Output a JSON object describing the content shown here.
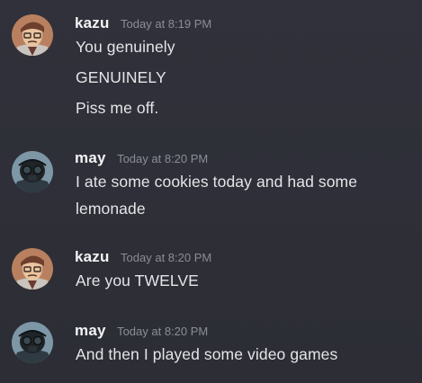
{
  "messages": [
    {
      "author": "kazu",
      "timestamp": "Today at 8:19 PM",
      "avatar": "kazu-avatar",
      "lines": [
        "You genuinely",
        "GENUINELY",
        "Piss me off."
      ]
    },
    {
      "author": "may",
      "timestamp": "Today at 8:20 PM",
      "avatar": "may-avatar",
      "lines": [
        "I ate some cookies today and had some",
        "lemonade"
      ]
    },
    {
      "author": "kazu",
      "timestamp": "Today at 8:20 PM",
      "avatar": "kazu-avatar",
      "lines": [
        "Are you TWELVE"
      ]
    },
    {
      "author": "may",
      "timestamp": "Today at 8:20 PM",
      "avatar": "may-avatar",
      "lines": [
        "And then I played some video games"
      ]
    }
  ],
  "colors": {
    "background": "#2e2f37",
    "author_name": "#f2f3f5",
    "timestamp": "#8b8e96",
    "message_text": "#e4e5e8"
  }
}
